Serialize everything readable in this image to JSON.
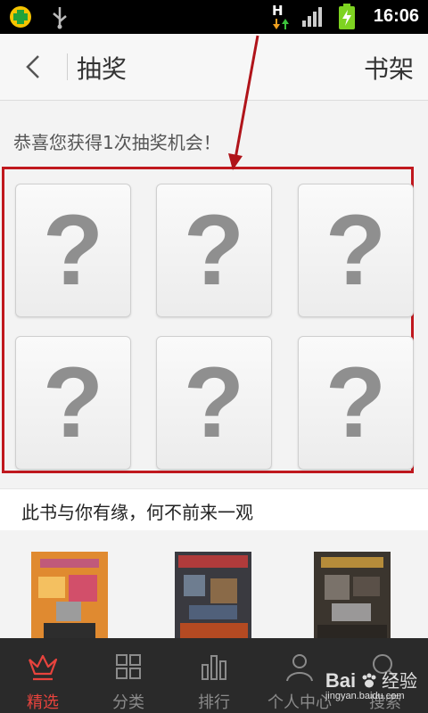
{
  "status_bar": {
    "time": "16:06",
    "network_label": "H",
    "icons": [
      "app-360-icon",
      "usb-icon",
      "network-h-icon",
      "signal-icon",
      "battery-charging-icon"
    ]
  },
  "header": {
    "title": "抽奖",
    "right_link": "书架",
    "back_icon": "back-arrow-icon"
  },
  "lottery": {
    "congrats_text": "恭喜您获得1次抽奖机会！",
    "cards": [
      {
        "label": "?"
      },
      {
        "label": "?"
      },
      {
        "label": "?"
      },
      {
        "label": "?"
      },
      {
        "label": "?"
      },
      {
        "label": "?"
      }
    ]
  },
  "recommend": {
    "heading": "此书与你有缘，何不前来一观",
    "books": [
      {
        "cover": "pixelated-book-cover"
      },
      {
        "cover": "pixelated-book-cover"
      },
      {
        "cover": "pixelated-book-cover"
      }
    ]
  },
  "tabbar": {
    "items": [
      {
        "label": "精选",
        "icon": "crown-icon",
        "active": true
      },
      {
        "label": "分类",
        "icon": "grid-icon",
        "active": false
      },
      {
        "label": "排行",
        "icon": "bar-chart-icon",
        "active": false
      },
      {
        "label": "个人中心",
        "icon": "person-icon",
        "active": false
      },
      {
        "label": "搜索",
        "icon": "search-icon",
        "active": false
      }
    ]
  },
  "watermark": {
    "brand": "Bai",
    "brand2": "经验",
    "url": "jingyan.baidu.com"
  },
  "colors": {
    "accent": "#e8433d",
    "highlight_border": "#c0181e",
    "tabbar_bg": "#2a2a2a"
  }
}
